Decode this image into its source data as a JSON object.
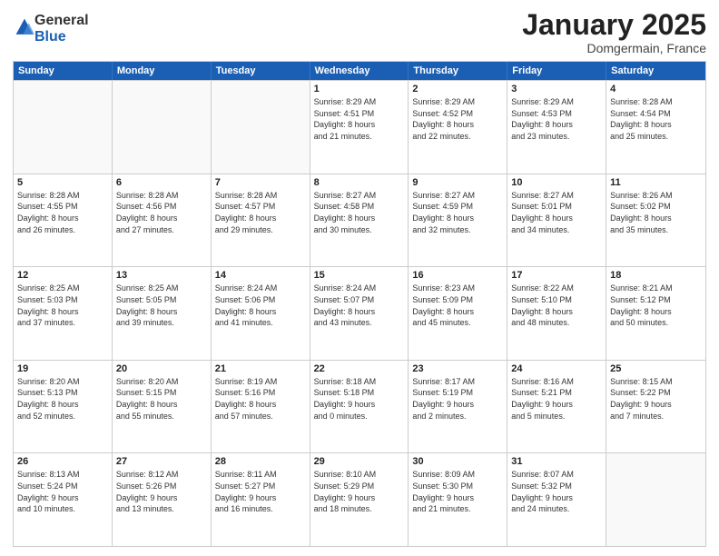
{
  "logo": {
    "general": "General",
    "blue": "Blue"
  },
  "header": {
    "month": "January 2025",
    "location": "Domgermain, France"
  },
  "weekdays": [
    "Sunday",
    "Monday",
    "Tuesday",
    "Wednesday",
    "Thursday",
    "Friday",
    "Saturday"
  ],
  "rows": [
    [
      {
        "day": "",
        "info": ""
      },
      {
        "day": "",
        "info": ""
      },
      {
        "day": "",
        "info": ""
      },
      {
        "day": "1",
        "info": "Sunrise: 8:29 AM\nSunset: 4:51 PM\nDaylight: 8 hours\nand 21 minutes."
      },
      {
        "day": "2",
        "info": "Sunrise: 8:29 AM\nSunset: 4:52 PM\nDaylight: 8 hours\nand 22 minutes."
      },
      {
        "day": "3",
        "info": "Sunrise: 8:29 AM\nSunset: 4:53 PM\nDaylight: 8 hours\nand 23 minutes."
      },
      {
        "day": "4",
        "info": "Sunrise: 8:28 AM\nSunset: 4:54 PM\nDaylight: 8 hours\nand 25 minutes."
      }
    ],
    [
      {
        "day": "5",
        "info": "Sunrise: 8:28 AM\nSunset: 4:55 PM\nDaylight: 8 hours\nand 26 minutes."
      },
      {
        "day": "6",
        "info": "Sunrise: 8:28 AM\nSunset: 4:56 PM\nDaylight: 8 hours\nand 27 minutes."
      },
      {
        "day": "7",
        "info": "Sunrise: 8:28 AM\nSunset: 4:57 PM\nDaylight: 8 hours\nand 29 minutes."
      },
      {
        "day": "8",
        "info": "Sunrise: 8:27 AM\nSunset: 4:58 PM\nDaylight: 8 hours\nand 30 minutes."
      },
      {
        "day": "9",
        "info": "Sunrise: 8:27 AM\nSunset: 4:59 PM\nDaylight: 8 hours\nand 32 minutes."
      },
      {
        "day": "10",
        "info": "Sunrise: 8:27 AM\nSunset: 5:01 PM\nDaylight: 8 hours\nand 34 minutes."
      },
      {
        "day": "11",
        "info": "Sunrise: 8:26 AM\nSunset: 5:02 PM\nDaylight: 8 hours\nand 35 minutes."
      }
    ],
    [
      {
        "day": "12",
        "info": "Sunrise: 8:25 AM\nSunset: 5:03 PM\nDaylight: 8 hours\nand 37 minutes."
      },
      {
        "day": "13",
        "info": "Sunrise: 8:25 AM\nSunset: 5:05 PM\nDaylight: 8 hours\nand 39 minutes."
      },
      {
        "day": "14",
        "info": "Sunrise: 8:24 AM\nSunset: 5:06 PM\nDaylight: 8 hours\nand 41 minutes."
      },
      {
        "day": "15",
        "info": "Sunrise: 8:24 AM\nSunset: 5:07 PM\nDaylight: 8 hours\nand 43 minutes."
      },
      {
        "day": "16",
        "info": "Sunrise: 8:23 AM\nSunset: 5:09 PM\nDaylight: 8 hours\nand 45 minutes."
      },
      {
        "day": "17",
        "info": "Sunrise: 8:22 AM\nSunset: 5:10 PM\nDaylight: 8 hours\nand 48 minutes."
      },
      {
        "day": "18",
        "info": "Sunrise: 8:21 AM\nSunset: 5:12 PM\nDaylight: 8 hours\nand 50 minutes."
      }
    ],
    [
      {
        "day": "19",
        "info": "Sunrise: 8:20 AM\nSunset: 5:13 PM\nDaylight: 8 hours\nand 52 minutes."
      },
      {
        "day": "20",
        "info": "Sunrise: 8:20 AM\nSunset: 5:15 PM\nDaylight: 8 hours\nand 55 minutes."
      },
      {
        "day": "21",
        "info": "Sunrise: 8:19 AM\nSunset: 5:16 PM\nDaylight: 8 hours\nand 57 minutes."
      },
      {
        "day": "22",
        "info": "Sunrise: 8:18 AM\nSunset: 5:18 PM\nDaylight: 9 hours\nand 0 minutes."
      },
      {
        "day": "23",
        "info": "Sunrise: 8:17 AM\nSunset: 5:19 PM\nDaylight: 9 hours\nand 2 minutes."
      },
      {
        "day": "24",
        "info": "Sunrise: 8:16 AM\nSunset: 5:21 PM\nDaylight: 9 hours\nand 5 minutes."
      },
      {
        "day": "25",
        "info": "Sunrise: 8:15 AM\nSunset: 5:22 PM\nDaylight: 9 hours\nand 7 minutes."
      }
    ],
    [
      {
        "day": "26",
        "info": "Sunrise: 8:13 AM\nSunset: 5:24 PM\nDaylight: 9 hours\nand 10 minutes."
      },
      {
        "day": "27",
        "info": "Sunrise: 8:12 AM\nSunset: 5:26 PM\nDaylight: 9 hours\nand 13 minutes."
      },
      {
        "day": "28",
        "info": "Sunrise: 8:11 AM\nSunset: 5:27 PM\nDaylight: 9 hours\nand 16 minutes."
      },
      {
        "day": "29",
        "info": "Sunrise: 8:10 AM\nSunset: 5:29 PM\nDaylight: 9 hours\nand 18 minutes."
      },
      {
        "day": "30",
        "info": "Sunrise: 8:09 AM\nSunset: 5:30 PM\nDaylight: 9 hours\nand 21 minutes."
      },
      {
        "day": "31",
        "info": "Sunrise: 8:07 AM\nSunset: 5:32 PM\nDaylight: 9 hours\nand 24 minutes."
      },
      {
        "day": "",
        "info": ""
      }
    ]
  ]
}
